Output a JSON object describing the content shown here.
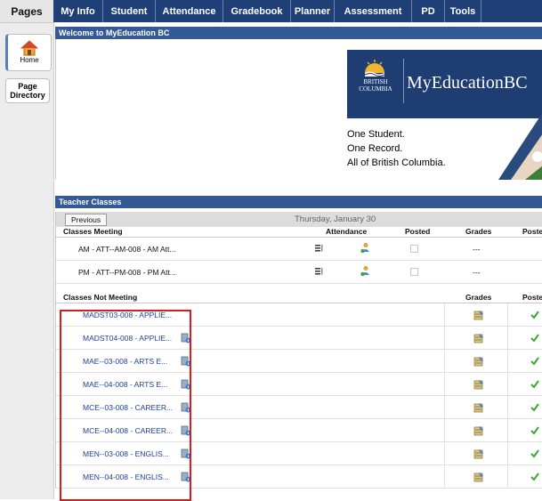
{
  "rail": {
    "title": "Pages",
    "home_label": "Home",
    "page_directory_label": "Page Directory"
  },
  "nav": {
    "tabs": [
      "My Info",
      "Student",
      "Attendance",
      "Gradebook",
      "Planner",
      "Assessment",
      "PD",
      "Tools"
    ]
  },
  "welcome": {
    "title": "Welcome to MyEducation BC",
    "banner": {
      "province_small": "BRITISH COLUMBIA",
      "brand": "MyEducationBC",
      "tagline": [
        "One Student.",
        "One Record.",
        "All of British Columbia."
      ]
    }
  },
  "teacher_classes": {
    "title": "Teacher Classes",
    "previous_label": "Previous",
    "date": "Thursday, January 30",
    "meeting_header": {
      "classes": "Classes Meeting",
      "attendance": "Attendance",
      "posted": "Posted",
      "grades": "Grades",
      "posted2": "Poste"
    },
    "meeting_rows": [
      {
        "name": "AM - ATT--AM-008 - AM Att...",
        "grades": "---"
      },
      {
        "name": "PM - ATT--PM-008 - PM Att...",
        "grades": "---"
      }
    ],
    "not_meeting_header": {
      "classes": "Classes Not Meeting",
      "grades": "Grades",
      "posted": "Poste"
    },
    "not_meeting_rows": [
      {
        "name": "MADST03-008 - APPLIE...",
        "has_icon": false
      },
      {
        "name": "MADST04-008 - APPLIE...",
        "has_icon": true
      },
      {
        "name": "MAE--03-008 - ARTS E...",
        "has_icon": true
      },
      {
        "name": "MAE--04-008 - ARTS E...",
        "has_icon": true
      },
      {
        "name": "MCE--03-008 - CAREER...",
        "has_icon": true
      },
      {
        "name": "MCE--04-008 - CAREER...",
        "has_icon": true
      },
      {
        "name": "MEN--03-008 - ENGLIS...",
        "has_icon": true
      },
      {
        "name": "MEN--04-008 - ENGLIS...",
        "has_icon": true
      }
    ]
  },
  "colors": {
    "nav": "#1f3f77",
    "section_bar": "#345a96",
    "link": "#1b3f9e",
    "highlight": "#d51d1d",
    "check": "#3aa832"
  }
}
